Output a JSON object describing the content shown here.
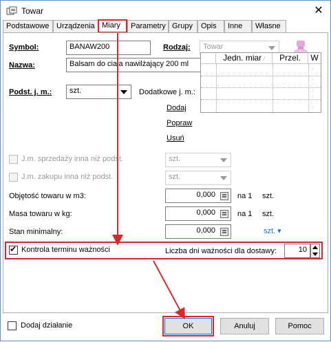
{
  "window": {
    "title": "Towar"
  },
  "tabs": [
    "Podstawowe",
    "Urządzenia",
    "Miary",
    "Parametry",
    "Grupy",
    "Opis",
    "Inne",
    "Własne"
  ],
  "form": {
    "symbol_label": "Symbol:",
    "symbol_value": "BANAW200",
    "rodzaj_label": "Rodzaj:",
    "rodzaj_value": "Towar",
    "nazwa_label": "Nazwa:",
    "nazwa_value": "Balsam do ciała nawilżający 200 ml"
  },
  "units": {
    "podst_label": "Podst. j. m.:",
    "podst_value": "szt.",
    "dodatkowe_label": "Dodatkowe j. m.:",
    "grid_headers": [
      "Jedn. miar",
      "Przel.",
      "W"
    ],
    "dodaj": "Dodaj",
    "popraw": "Popraw",
    "usun": "Usuń"
  },
  "sales": {
    "sprzedazy_label": "J.m. sprzedaży inna niż podst.",
    "sprzedazy_value": "szt.",
    "zakupu_label": "J.m. zakupu inna niż podst.",
    "zakupu_value": "szt."
  },
  "measures": {
    "objetosc_label": "Objętość towaru w m3:",
    "objetosc_value": "0,000",
    "objetosc_na": "na 1",
    "objetosc_unit": "szt.",
    "masa_label": "Masa towaru w kg:",
    "masa_value": "0,000",
    "masa_na": "na 1",
    "masa_unit": "szt.",
    "stan_label": "Stan minimalny:",
    "stan_value": "0,000",
    "stan_unit_link": "szt. ▾"
  },
  "expiry": {
    "kontrola_label": "Kontrola terminu ważności",
    "liczba_label": "Liczba dni ważności dla dostawy:",
    "liczba_value": "10"
  },
  "footer": {
    "dodaj_dzialanie": "Dodaj działanie",
    "ok": "OK",
    "anuluj": "Anuluj",
    "pomoc": "Pomoc"
  },
  "colors": {
    "highlight": "#d8262b",
    "link_blue": "#1e6fd0",
    "window_border": "#5a8fd6"
  }
}
